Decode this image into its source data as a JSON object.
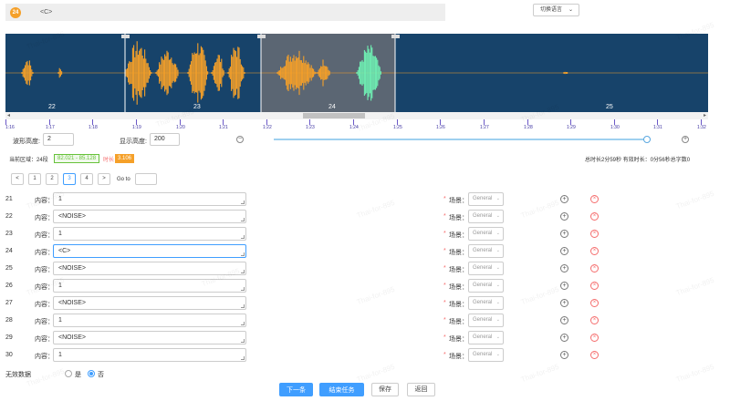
{
  "header": {
    "segment_number": "24",
    "segment_text": "<C>",
    "lang_button": "切换语言"
  },
  "waveform": {
    "segment_labels": [
      "22",
      "23",
      "24",
      "25"
    ],
    "colors": {
      "background": "#17436a",
      "wave": "#f5a029",
      "active_wave": "#6ff0b4",
      "selection": "#5b6673"
    }
  },
  "timeline_labels": [
    "1:16",
    "1:17",
    "1:18",
    "1:19",
    "1:20",
    "1:21",
    "1:22",
    "1:23",
    "1:24",
    "1:25",
    "1:26",
    "1:27",
    "1:28",
    "1:29",
    "1:30",
    "1:31",
    "1:32"
  ],
  "controls": {
    "wave_height_label": "波形高度:",
    "wave_height_value": "2",
    "display_height_label": "显示高度:",
    "display_height_value": "200",
    "zoom_level": 0.99
  },
  "info": {
    "current_region_label": "当前区域：24段",
    "range": "82.021 - 85.128",
    "duration_label": "时长",
    "duration_value": "3.106",
    "summary": "总时长2分59秒  有效时长：0分56秒总字数0"
  },
  "pagination": {
    "prev": "<",
    "pages": [
      "1",
      "2",
      "3",
      "4"
    ],
    "active_page": "3",
    "next": ">",
    "goto_label": "Go to"
  },
  "rows": [
    {
      "num": "21",
      "label": "内容：",
      "text": "1",
      "scene_label": "场景：",
      "scene": "General"
    },
    {
      "num": "22",
      "label": "内容：",
      "text": "<NOISE>",
      "scene_label": "场景：",
      "scene": "General"
    },
    {
      "num": "23",
      "label": "内容：",
      "text": "1",
      "scene_label": "场景：",
      "scene": "General"
    },
    {
      "num": "24",
      "label": "内容：",
      "text": "<C>",
      "scene_label": "场景：",
      "scene": "General"
    },
    {
      "num": "25",
      "label": "内容：",
      "text": "<NOISE>",
      "scene_label": "场景：",
      "scene": "General"
    },
    {
      "num": "26",
      "label": "内容：",
      "text": "1",
      "scene_label": "场景：",
      "scene": "General"
    },
    {
      "num": "27",
      "label": "内容：",
      "text": "<NOISE>",
      "scene_label": "场景：",
      "scene": "General"
    },
    {
      "num": "28",
      "label": "内容：",
      "text": "1",
      "scene_label": "场景：",
      "scene": "General"
    },
    {
      "num": "29",
      "label": "内容：",
      "text": "<NOISE>",
      "scene_label": "场景：",
      "scene": "General"
    },
    {
      "num": "30",
      "label": "内容：",
      "text": "1",
      "scene_label": "场景：",
      "scene": "General"
    }
  ],
  "invalid": {
    "label": "无效数据",
    "yes": "是",
    "no": "否",
    "selected": "no"
  },
  "buttons": {
    "next": "下一条",
    "finish": "结束任务",
    "save": "保存",
    "back": "返回"
  },
  "watermark": "Thai-for-895"
}
